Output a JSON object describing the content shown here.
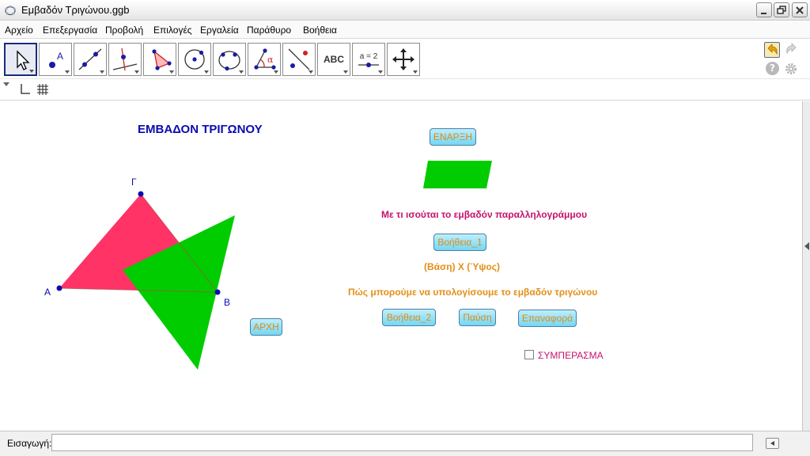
{
  "window": {
    "title": "Εμβαδόν Τριγώνου.ggb"
  },
  "menu": [
    "Αρχείο",
    "Επεξεργασία",
    "Προβολή",
    "Επιλογές",
    "Εργαλεία",
    "Παράθυρο",
    "Βοήθεια"
  ],
  "toolbar": {
    "tools": [
      "move-tool",
      "point-tool",
      "line-tool",
      "perpendicular-line-tool",
      "polygon-tool",
      "circle-tool",
      "circle-three-points-tool",
      "angle-tool",
      "reflect-tool",
      "text-tool",
      "slider-tool",
      "move-view-tool"
    ],
    "text_tool_label": "ABC",
    "slider_tool_label": "a = 2",
    "help_label": "?"
  },
  "canvas": {
    "heading": "ΕΜΒΑΔΟΝ ΤΡΙΓΩΝΟΥ",
    "points": {
      "a": "Α",
      "b": "Β",
      "g": "Γ"
    },
    "question_1": "Με τι ισούται το εμβαδόν παραλληλογράμμου",
    "answer_1": "(Βάση) Χ (Ύψος)",
    "question_2": "Πώς μπορούμε να υπολογίσουμε το εμβαδόν τριγώνου",
    "buttons": {
      "start": "ΕΝΑΡΞΗ",
      "help_1": "Βοήθεια_1",
      "help_2": "Βοήθεια_2",
      "pause": "Παύση",
      "reset": "Επαναφορά",
      "home": "ΑΡΧΗ"
    },
    "checkbox": {
      "label": "ΣΥΜΠΕΡΑΣΜΑ",
      "checked": false
    },
    "colors": {
      "triangle": "#ff3366",
      "parallelogram": "#00cc00",
      "points": "#0b0bb0",
      "heading": "#0b0bb0",
      "question_1": "#c5126d",
      "answers": "#e39018"
    }
  },
  "input_bar": {
    "label": "Εισαγωγή:",
    "value": ""
  }
}
